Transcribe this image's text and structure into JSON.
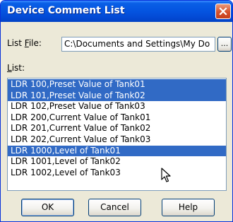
{
  "window": {
    "title": "Device Comment List"
  },
  "list_file": {
    "label_prefix": "List ",
    "label_accel": "F",
    "label_suffix": "ile:",
    "value": "C:\\Documents and Settings\\My Do",
    "browse_label": "..."
  },
  "list": {
    "label_accel": "L",
    "label_suffix": "ist:",
    "items": [
      {
        "text": "LDR 100,Preset Value of Tank01",
        "selected": true
      },
      {
        "text": "LDR 101,Preset Value of Tank02",
        "selected": true
      },
      {
        "text": "LDR 102,Preset Value of Tank03",
        "selected": false
      },
      {
        "text": "LDR 200,Current Value of Tank01",
        "selected": false
      },
      {
        "text": "LDR 201,Current Value of Tank02",
        "selected": false
      },
      {
        "text": "LDR 202,Current Value of Tank03",
        "selected": false
      },
      {
        "text": "LDR 1000,Level of Tank01",
        "selected": true
      },
      {
        "text": "LDR 1001,Level of Tank02",
        "selected": false
      },
      {
        "text": "LDR 1002,Level of Tank03",
        "selected": false
      }
    ]
  },
  "buttons": {
    "ok": "OK",
    "cancel": "Cancel",
    "help": "Help"
  },
  "colors": {
    "selection": "#316ac5",
    "titlebar": "#0454e0",
    "close": "#d5512c"
  },
  "icons": {
    "close": "close-icon",
    "cursor": "mouse-pointer-icon"
  }
}
